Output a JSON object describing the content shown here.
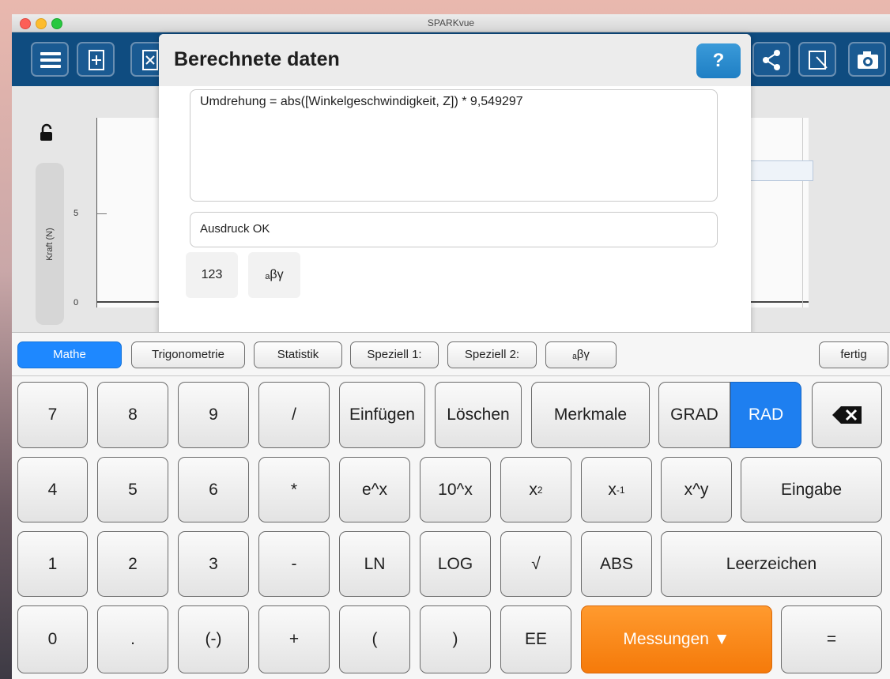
{
  "window": {
    "title": "SPARKvue"
  },
  "toolbar": {
    "buttons": [
      "menu-icon",
      "add-page-icon",
      "delete-page-icon",
      "share-icon",
      "export-icon",
      "camera-icon"
    ]
  },
  "graph": {
    "y_axis_label": "Kraft (N)",
    "y_ticks": [
      "5",
      "0"
    ]
  },
  "dialog": {
    "title": "Berechnete daten",
    "help_label": "?",
    "expression": "Umdrehung = abs([Winkelgeschwindigkeit, Z]) * 9,549297",
    "status": "Ausdruck OK",
    "mini_keys": [
      "123",
      "ₐβγ"
    ]
  },
  "keyboard": {
    "tabs": [
      "Mathe",
      "Trigonometrie",
      "Statistik",
      "Speziell 1:",
      "Speziell 2:",
      "ₐβγ"
    ],
    "done_label": "fertig",
    "row1": [
      "7",
      "8",
      "9",
      "/",
      "Einfügen",
      "Löschen",
      "Merkmale",
      "GRAD",
      "RAD"
    ],
    "row2": [
      "4",
      "5",
      "6",
      "*",
      "e^x",
      "10^x",
      "x",
      "x",
      "x^y",
      "Eingabe"
    ],
    "row2_sup": [
      "2",
      "-1"
    ],
    "row3": [
      "1",
      "2",
      "3",
      "-",
      "LN",
      "LOG",
      "√",
      "ABS",
      "Leerzeichen"
    ],
    "row4": [
      "0",
      ".",
      "(-)",
      "+",
      "(",
      ")",
      "EE",
      "Messungen ▼",
      "="
    ]
  },
  "colors": {
    "toolbar": "#0f4c80",
    "active_tab": "#1e88ff",
    "rad_key": "#1e7ff0",
    "measurements_key": "#f57a0a"
  }
}
